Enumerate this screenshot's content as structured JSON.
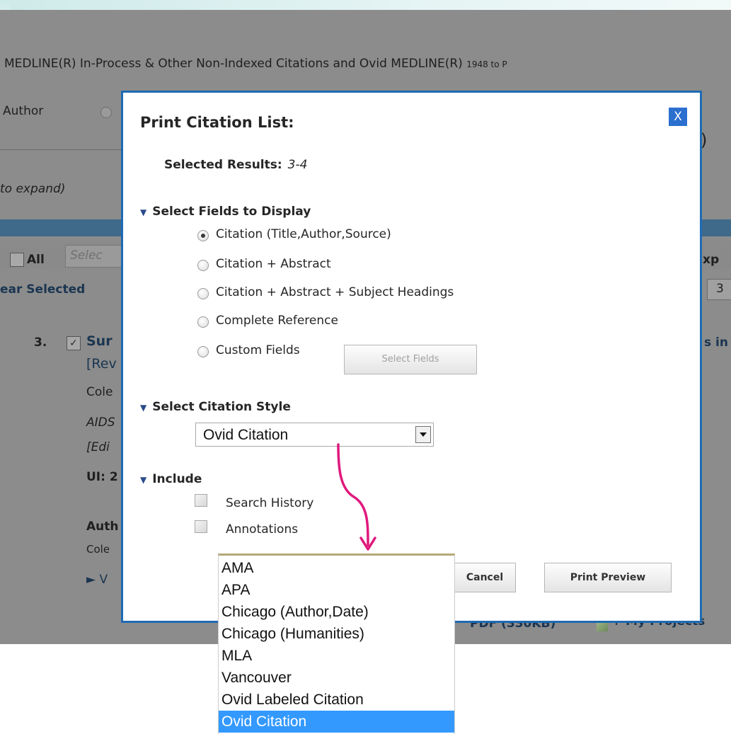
{
  "background": {
    "db_title": "MEDLINE(R) In-Process & Other Non-Indexed Citations and Ovid MEDLINE(R)",
    "db_years": "1948 to P",
    "author_label": "Author",
    "to_expand": "to expand)",
    "all_label": "All",
    "select_placeholder": "Selec",
    "exp_label": "xp",
    "clear_selected": "ear Selected",
    "page_number": "3",
    "result_number": "3.",
    "result_title_start": "Sur",
    "result_review": "[Rev",
    "result_si": "s in",
    "author_start": "Cole",
    "journal_start": "AIDS",
    "edi_start": "[Edi",
    "ui_start": "UI: 2",
    "auth_start": "Auth",
    "cole_start": "Cole",
    "view_start": "V",
    "paren": ")",
    "pdf_link": "PDF (330KB)",
    "my_projects": "+ My Projects"
  },
  "dialog": {
    "title": "Print Citation List:",
    "close_label": "X",
    "selected_results_label": "Selected Results:",
    "selected_results_value": "3-4",
    "fields_section": "Select Fields to Display",
    "field_options": [
      {
        "label": "Citation (Title,Author,Source)",
        "selected": true
      },
      {
        "label": "Citation + Abstract",
        "selected": false
      },
      {
        "label": "Citation + Abstract + Subject Headings",
        "selected": false
      },
      {
        "label": "Complete Reference",
        "selected": false
      },
      {
        "label": "Custom Fields",
        "selected": false
      }
    ],
    "select_fields_button": "Select Fields",
    "style_section": "Select Citation Style",
    "style_value": "Ovid Citation",
    "include_section": "Include",
    "include_options": [
      {
        "label": "Search History",
        "checked": false
      },
      {
        "label": "Annotations",
        "checked": false
      }
    ],
    "cancel_button": "Cancel",
    "print_preview_button": "Print Preview"
  },
  "style_dropdown": {
    "options": [
      "AMA",
      "APA",
      "Chicago (Author,Date)",
      "Chicago (Humanities)",
      "MLA",
      "Vancouver",
      "Ovid Labeled Citation",
      "Ovid Citation"
    ],
    "selected": "Ovid Citation"
  },
  "colors": {
    "dialog_border": "#1f6bb3",
    "close_button": "#2b6fcf",
    "selection_highlight": "#3399ff",
    "annotation_arrow": "#e0197d"
  }
}
